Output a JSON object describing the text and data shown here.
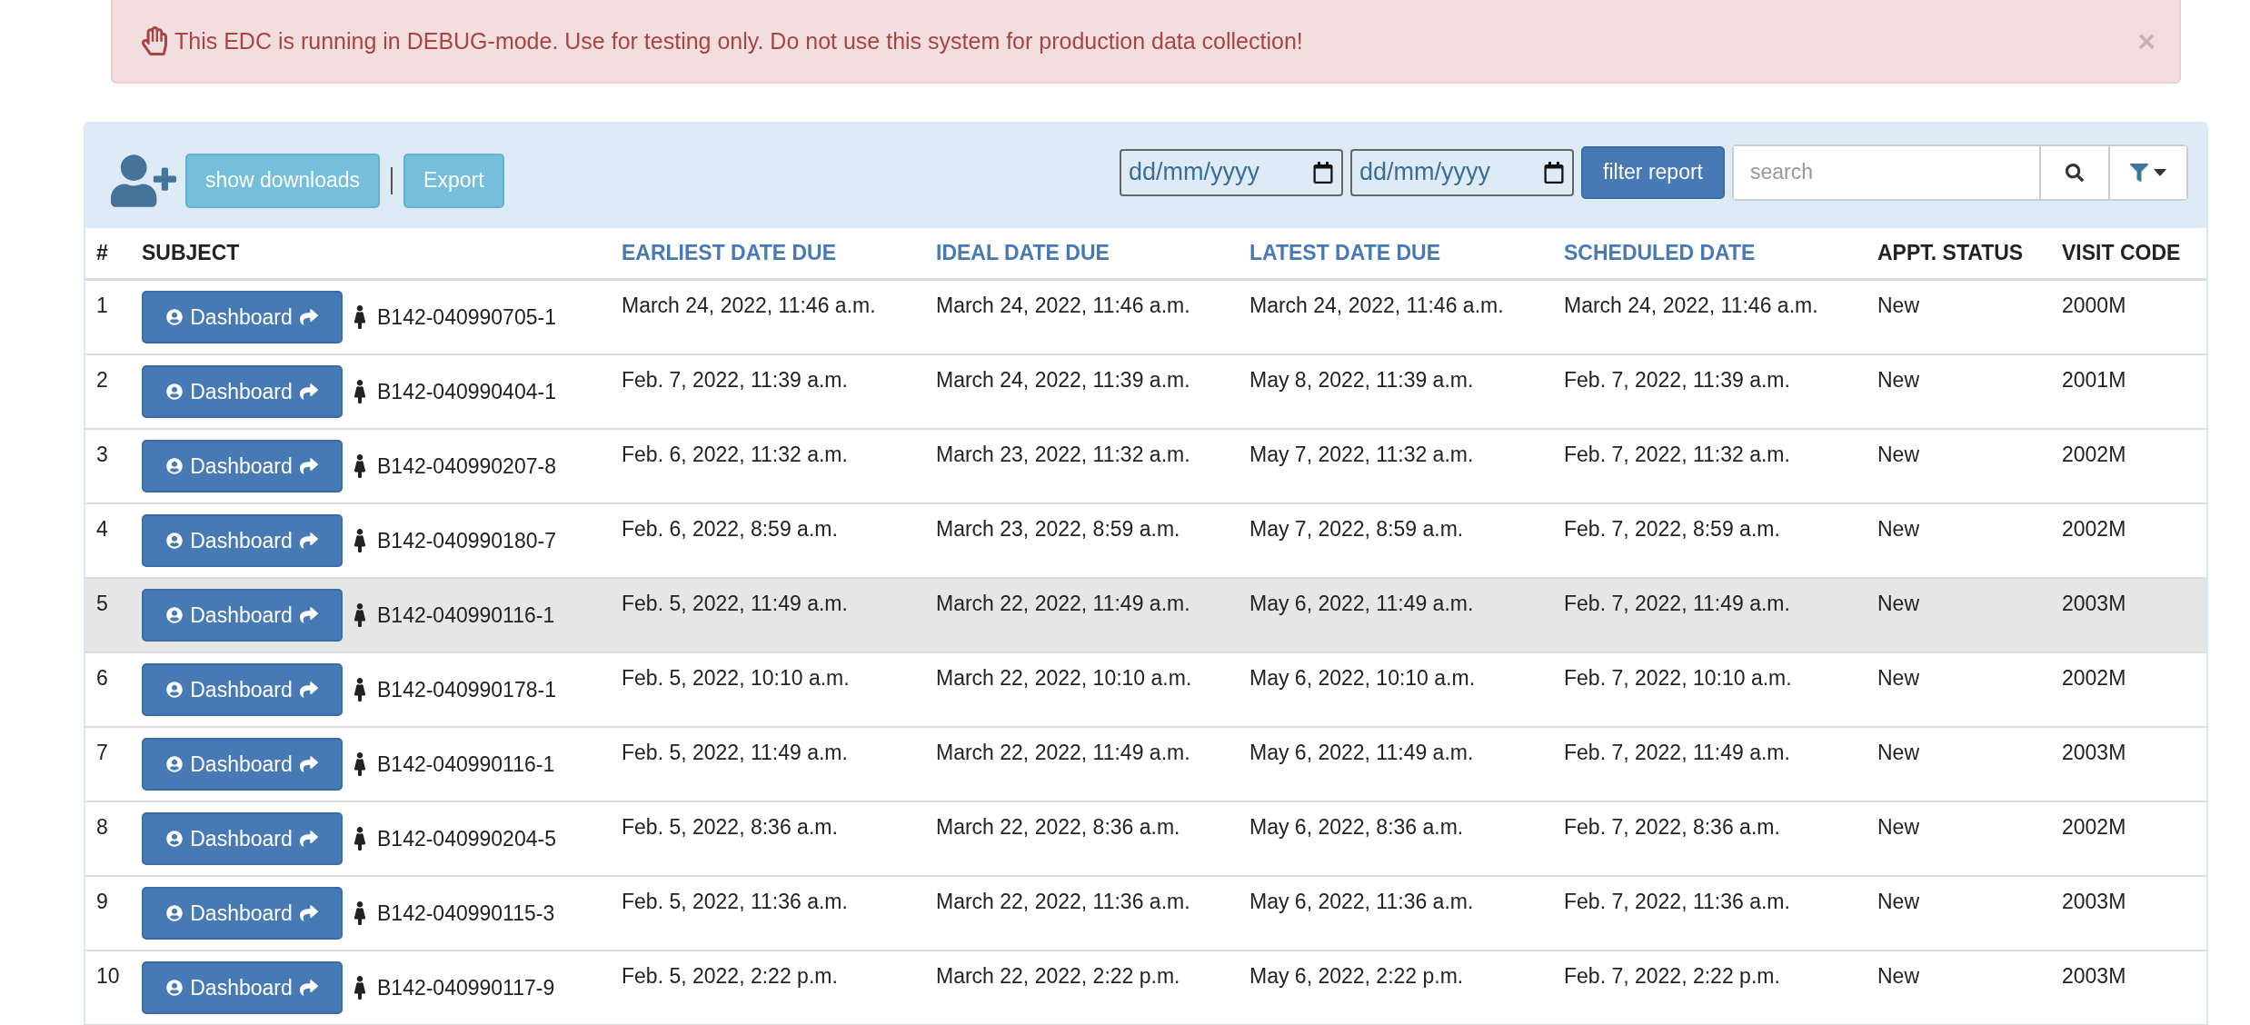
{
  "alert": {
    "message": "This EDC is running in DEBUG-mode. Use for testing only. Do not use this system for production data collection!",
    "close": "×"
  },
  "toolbar": {
    "buttons": [
      "show downloads",
      "Export"
    ],
    "date_fields": [
      {
        "placeholder": "dd/mm/yyyy"
      },
      {
        "placeholder": "dd/mm/yyyy"
      }
    ],
    "filter_button": "filter report",
    "search": {
      "placeholder": "search"
    }
  },
  "table": {
    "columns": [
      {
        "label": "#",
        "sortable": false
      },
      {
        "label": "SUBJECT",
        "sortable": false
      },
      {
        "label": "EARLIEST DATE DUE",
        "sortable": true
      },
      {
        "label": "IDEAL DATE DUE",
        "sortable": true
      },
      {
        "label": "LATEST DATE DUE",
        "sortable": true
      },
      {
        "label": "SCHEDULED DATE",
        "sortable": true
      },
      {
        "label": "APPT. STATUS",
        "sortable": false
      },
      {
        "label": "VISIT CODE",
        "sortable": false
      }
    ],
    "rows": [
      {
        "index": "1",
        "action": "Dashboard",
        "subject": "B142-040990705-1",
        "earliest": "March 24, 2022, 11:46 a.m.",
        "ideal": "March 24, 2022, 11:46 a.m.",
        "latest": "March 24, 2022, 11:46 a.m.",
        "scheduled": "March 24, 2022, 11:46 a.m.",
        "status": "New",
        "visit_code": "2000M",
        "highlighted": false
      },
      {
        "index": "2",
        "action": "Dashboard",
        "subject": "B142-040990404-1",
        "earliest": "Feb. 7, 2022, 11:39 a.m.",
        "ideal": "March 24, 2022, 11:39 a.m.",
        "latest": "May 8, 2022, 11:39 a.m.",
        "scheduled": "Feb. 7, 2022, 11:39 a.m.",
        "status": "New",
        "visit_code": "2001M",
        "highlighted": false
      },
      {
        "index": "3",
        "action": "Dashboard",
        "subject": "B142-040990207-8",
        "earliest": "Feb. 6, 2022, 11:32 a.m.",
        "ideal": "March 23, 2022, 11:32 a.m.",
        "latest": "May 7, 2022, 11:32 a.m.",
        "scheduled": "Feb. 7, 2022, 11:32 a.m.",
        "status": "New",
        "visit_code": "2002M",
        "highlighted": false
      },
      {
        "index": "4",
        "action": "Dashboard",
        "subject": "B142-040990180-7",
        "earliest": "Feb. 6, 2022, 8:59 a.m.",
        "ideal": "March 23, 2022, 8:59 a.m.",
        "latest": "May 7, 2022, 8:59 a.m.",
        "scheduled": "Feb. 7, 2022, 8:59 a.m.",
        "status": "New",
        "visit_code": "2002M",
        "highlighted": false
      },
      {
        "index": "5",
        "action": "Dashboard",
        "subject": "B142-040990116-1",
        "earliest": "Feb. 5, 2022, 11:49 a.m.",
        "ideal": "March 22, 2022, 11:49 a.m.",
        "latest": "May 6, 2022, 11:49 a.m.",
        "scheduled": "Feb. 7, 2022, 11:49 a.m.",
        "status": "New",
        "visit_code": "2003M",
        "highlighted": true
      },
      {
        "index": "6",
        "action": "Dashboard",
        "subject": "B142-040990178-1",
        "earliest": "Feb. 5, 2022, 10:10 a.m.",
        "ideal": "March 22, 2022, 10:10 a.m.",
        "latest": "May 6, 2022, 10:10 a.m.",
        "scheduled": "Feb. 7, 2022, 10:10 a.m.",
        "status": "New",
        "visit_code": "2002M",
        "highlighted": false
      },
      {
        "index": "7",
        "action": "Dashboard",
        "subject": "B142-040990116-1",
        "earliest": "Feb. 5, 2022, 11:49 a.m.",
        "ideal": "March 22, 2022, 11:49 a.m.",
        "latest": "May 6, 2022, 11:49 a.m.",
        "scheduled": "Feb. 7, 2022, 11:49 a.m.",
        "status": "New",
        "visit_code": "2003M",
        "highlighted": false
      },
      {
        "index": "8",
        "action": "Dashboard",
        "subject": "B142-040990204-5",
        "earliest": "Feb. 5, 2022, 8:36 a.m.",
        "ideal": "March 22, 2022, 8:36 a.m.",
        "latest": "May 6, 2022, 8:36 a.m.",
        "scheduled": "Feb. 7, 2022, 8:36 a.m.",
        "status": "New",
        "visit_code": "2002M",
        "highlighted": false
      },
      {
        "index": "9",
        "action": "Dashboard",
        "subject": "B142-040990115-3",
        "earliest": "Feb. 5, 2022, 11:36 a.m.",
        "ideal": "March 22, 2022, 11:36 a.m.",
        "latest": "May 6, 2022, 11:36 a.m.",
        "scheduled": "Feb. 7, 2022, 11:36 a.m.",
        "status": "New",
        "visit_code": "2003M",
        "highlighted": false
      },
      {
        "index": "10",
        "action": "Dashboard",
        "subject": "B142-040990117-9",
        "earliest": "Feb. 5, 2022, 2:22 p.m.",
        "ideal": "March 22, 2022, 2:22 p.m.",
        "latest": "May 6, 2022, 2:22 p.m.",
        "scheduled": "Feb. 7, 2022, 2:22 p.m.",
        "status": "New",
        "visit_code": "2003M",
        "highlighted": false
      }
    ]
  }
}
